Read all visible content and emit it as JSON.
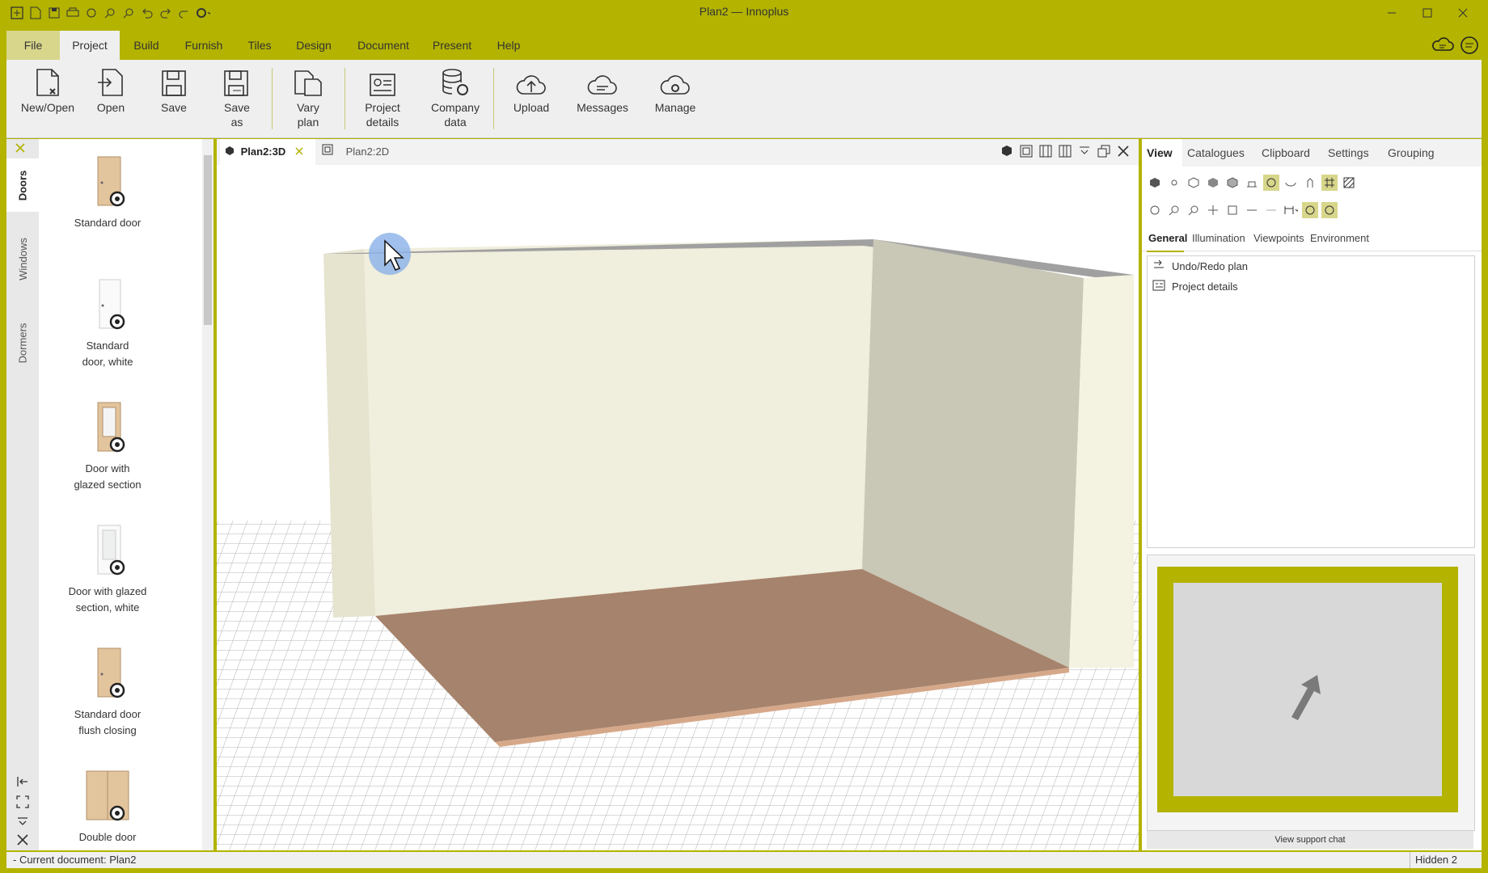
{
  "window": {
    "title": "Plan2 — Innoplus"
  },
  "menu": [
    "File",
    "Project",
    "Build",
    "Furnish",
    "Tiles",
    "Design",
    "Document",
    "Present",
    "Help"
  ],
  "ribbon": {
    "new_open": "New/Open",
    "open": "Open",
    "save": "Save",
    "save_as_1": "Save",
    "save_as_2": "as",
    "vary_1": "Vary",
    "vary_2": "plan",
    "project_details_1": "Project",
    "project_details_2": "details",
    "company_data_1": "Company",
    "company_data_2": "data",
    "upload": "Upload",
    "messages": "Messages",
    "manage": "Manage"
  },
  "left_tabs": [
    "Doors",
    "Windows",
    "Dormers"
  ],
  "catalogue": [
    {
      "line1": "Standard door",
      "line2": ""
    },
    {
      "line1": "Standard",
      "line2": "door, white"
    },
    {
      "line1": "Door with",
      "line2": "glazed section"
    },
    {
      "line1": "Door with glazed",
      "line2": "section, white"
    },
    {
      "line1": "Standard door",
      "line2": "flush closing"
    },
    {
      "line1": "Double door",
      "line2": ""
    }
  ],
  "doc_tabs": {
    "tab_3d": "Plan2:3D",
    "tab_2d": "Plan2:2D"
  },
  "right_tabs": [
    "View",
    "Catalogues",
    "Clipboard",
    "Settings",
    "Grouping"
  ],
  "sub_tabs": [
    "General",
    "Illumination",
    "Viewpoints",
    "Environment"
  ],
  "right_list": [
    "Undo/Redo plan",
    "Project details"
  ],
  "support": "View support chat",
  "status": {
    "left": "- Current document: Plan2",
    "right": "Hidden 2"
  },
  "colors": {
    "accent": "#b3b300",
    "floor": "#a6836c",
    "wall": "#f1efdf"
  }
}
